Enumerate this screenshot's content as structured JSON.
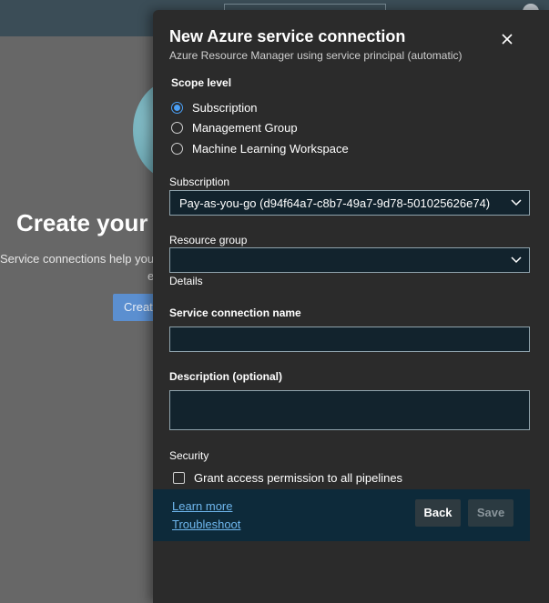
{
  "background": {
    "title": "Create your fi",
    "description_line1": "Service connections help you r",
    "description_line2": "e",
    "button_label": "Create"
  },
  "panel": {
    "title": "New Azure service connection",
    "subtitle": "Azure Resource Manager using service principal (automatic)",
    "close_icon": "close-icon",
    "scope": {
      "label": "Scope level",
      "options": [
        {
          "label": "Subscription",
          "checked": true
        },
        {
          "label": "Management Group",
          "checked": false
        },
        {
          "label": "Machine Learning Workspace",
          "checked": false
        }
      ]
    },
    "subscription": {
      "label": "Subscription",
      "value": "Pay-as-you-go (d94f64a7-c8b7-49a7-9d78-501025626e74)"
    },
    "resource_group": {
      "label": "Resource group",
      "value": ""
    },
    "details_label": "Details",
    "service_connection_name": {
      "label": "Service connection name",
      "value": ""
    },
    "description": {
      "label": "Description (optional)",
      "value": ""
    },
    "security": {
      "label": "Security",
      "grant_access_label": "Grant access permission to all pipelines",
      "grant_access_checked": false
    },
    "footer": {
      "learn_more": "Learn more",
      "troubleshoot": "Troubleshoot",
      "back_label": "Back",
      "save_label": "Save"
    }
  },
  "colors": {
    "accent": "#4a9ff5",
    "link": "#6fb7ee",
    "panel_bg": "#2b2b2b",
    "field_bg": "#12232d",
    "footer_bg": "#0d2a3a"
  }
}
